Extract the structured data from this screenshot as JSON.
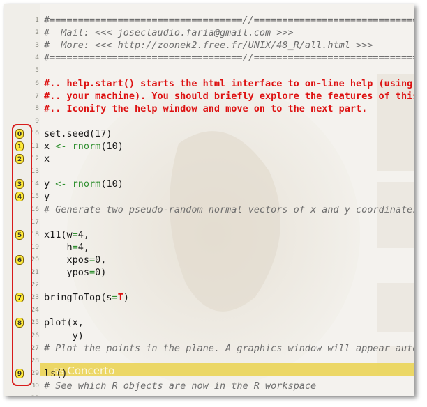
{
  "editor": {
    "watermark_text": "ss Concerto",
    "lines": [
      {
        "n": "1",
        "parts": [
          {
            "t": "#==================================//=================================",
            "c": "gray"
          }
        ]
      },
      {
        "n": "2",
        "parts": [
          {
            "t": "#  Mail: <<< joseclaudio.faria@gmail.com >>>",
            "c": "gray"
          }
        ]
      },
      {
        "n": "3",
        "parts": [
          {
            "t": "#  More: <<< http://zoonek2.free.fr/UNIX/48_R/all.html >>>",
            "c": "gray"
          }
        ]
      },
      {
        "n": "4",
        "parts": [
          {
            "t": "#==================================//=================================",
            "c": "gray"
          }
        ]
      },
      {
        "n": "5",
        "parts": []
      },
      {
        "n": "6",
        "parts": [
          {
            "t": "#.. help.start() starts the html interface to on-line help (using a web browser available at",
            "c": "red"
          }
        ]
      },
      {
        "n": "7",
        "parts": [
          {
            "t": "#.. your machine). You should briefly explore the features of this facility with the mouse.",
            "c": "red"
          }
        ]
      },
      {
        "n": "8",
        "parts": [
          {
            "t": "#.. Iconify the help window and move on to the next part.",
            "c": "red"
          }
        ]
      },
      {
        "n": "9",
        "parts": []
      },
      {
        "n": "10",
        "parts": [
          {
            "t": "set.seed(17)",
            "c": "dark"
          }
        ]
      },
      {
        "n": "11",
        "parts": [
          {
            "t": "x ",
            "c": "dark"
          },
          {
            "t": "<-",
            "c": "green"
          },
          {
            "t": " ",
            "c": "dark"
          },
          {
            "t": "rnorm",
            "c": "green"
          },
          {
            "t": "(10)",
            "c": "dark"
          }
        ]
      },
      {
        "n": "12",
        "parts": [
          {
            "t": "x",
            "c": "dark"
          }
        ]
      },
      {
        "n": "13",
        "parts": []
      },
      {
        "n": "14",
        "parts": [
          {
            "t": "y ",
            "c": "dark"
          },
          {
            "t": "<-",
            "c": "green"
          },
          {
            "t": " ",
            "c": "dark"
          },
          {
            "t": "rnorm",
            "c": "green"
          },
          {
            "t": "(10)",
            "c": "dark"
          }
        ]
      },
      {
        "n": "15",
        "parts": [
          {
            "t": "y",
            "c": "dark"
          }
        ]
      },
      {
        "n": "16",
        "parts": [
          {
            "t": "# Generate two pseudo-random normal vectors of x and y coordinates.",
            "c": "gray"
          }
        ]
      },
      {
        "n": "17",
        "parts": []
      },
      {
        "n": "18",
        "parts": [
          {
            "t": "x11(w",
            "c": "dark"
          },
          {
            "t": "=",
            "c": "green"
          },
          {
            "t": "4,",
            "c": "dark"
          }
        ]
      },
      {
        "n": "19",
        "parts": [
          {
            "t": "    h",
            "c": "dark"
          },
          {
            "t": "=",
            "c": "green"
          },
          {
            "t": "4,",
            "c": "dark"
          }
        ]
      },
      {
        "n": "20",
        "parts": [
          {
            "t": "    xpos",
            "c": "dark"
          },
          {
            "t": "=",
            "c": "green"
          },
          {
            "t": "0,",
            "c": "dark"
          }
        ]
      },
      {
        "n": "21",
        "parts": [
          {
            "t": "    ypos",
            "c": "dark"
          },
          {
            "t": "=",
            "c": "green"
          },
          {
            "t": "0)",
            "c": "dark"
          }
        ]
      },
      {
        "n": "22",
        "parts": []
      },
      {
        "n": "23",
        "parts": [
          {
            "t": "bringToTop(s",
            "c": "dark"
          },
          {
            "t": "=",
            "c": "green"
          },
          {
            "t": "T",
            "c": "red"
          },
          {
            "t": ")",
            "c": "dark"
          }
        ]
      },
      {
        "n": "24",
        "parts": []
      },
      {
        "n": "25",
        "parts": [
          {
            "t": "plot(x,",
            "c": "dark"
          }
        ]
      },
      {
        "n": "26",
        "parts": [
          {
            "t": "     y)",
            "c": "dark"
          }
        ]
      },
      {
        "n": "27",
        "parts": [
          {
            "t": "# Plot the points in the plane. A graphics window will appear automatically.",
            "c": "gray"
          }
        ]
      },
      {
        "n": "28",
        "parts": []
      },
      {
        "n": "29",
        "parts": [
          {
            "t": "l",
            "c": "dark"
          },
          {
            "t": "s()",
            "c": "dark",
            "caret": true
          }
        ]
      },
      {
        "n": "30",
        "parts": [
          {
            "t": "# See which R objects are now in the R workspace",
            "c": "gray"
          }
        ]
      },
      {
        "n": "31",
        "parts": []
      }
    ]
  },
  "markers": [
    {
      "label": "0",
      "line": "10"
    },
    {
      "label": "1",
      "line": "11"
    },
    {
      "label": "2",
      "line": "12"
    },
    {
      "label": "3",
      "line": "14"
    },
    {
      "label": "4",
      "line": "15"
    },
    {
      "label": "5",
      "line": "18"
    },
    {
      "label": "6",
      "line": "20"
    },
    {
      "label": "7",
      "line": "23"
    },
    {
      "label": "8",
      "line": "25"
    },
    {
      "label": "9",
      "line": "29"
    }
  ],
  "colors": {
    "comment_gray": "#6f6f6f",
    "comment_red": "#dd1111",
    "operator_green": "#2f8f2f",
    "current_line": "#ead55a",
    "marker_yellow": "#ffeb3b",
    "callout_red": "#d81b1b"
  }
}
